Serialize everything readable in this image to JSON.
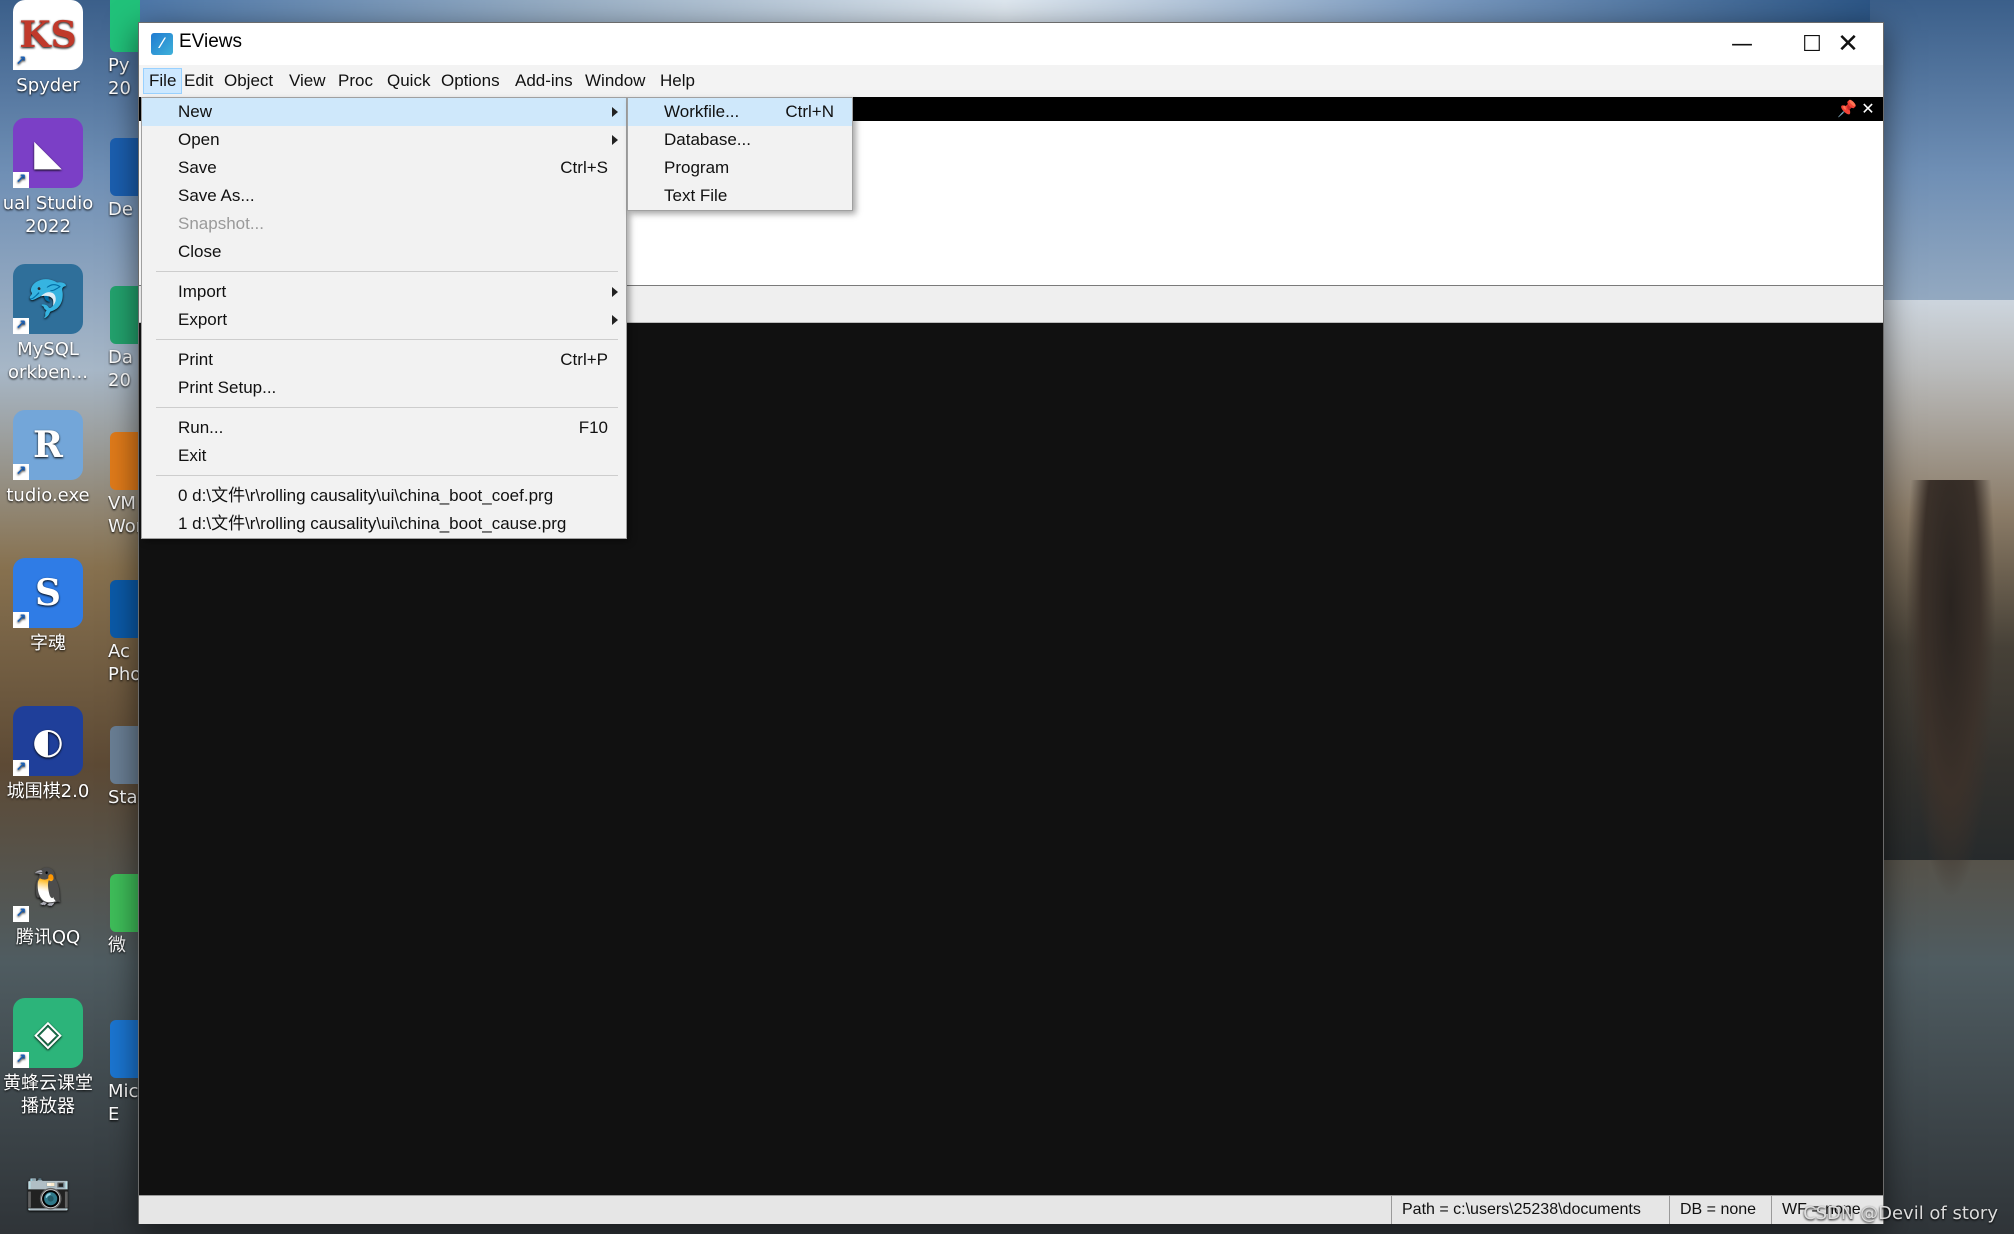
{
  "desktop": {
    "icons": [
      {
        "label": "Spyder",
        "icon": "spyder-icon",
        "glyph": "KS",
        "color": "#ffffff"
      },
      {
        "label": "ual Studio\n2022",
        "icon": "visual-studio-icon",
        "glyph": "◣",
        "color": "#7b3fc6"
      },
      {
        "label": "MySQL\norkben...",
        "icon": "mysql-workbench-icon",
        "glyph": "🐬",
        "color": "#2f6f9a"
      },
      {
        "label": "tudio.exe",
        "icon": "rstudio-icon",
        "glyph": "R",
        "color": "#73a6d9"
      },
      {
        "label": "字魂",
        "icon": "zihun-icon",
        "glyph": "S",
        "color": "#2f7ce6"
      },
      {
        "label": "城围棋2.0",
        "icon": "weiqi-icon",
        "glyph": "◐",
        "color": "#1f3f9a"
      },
      {
        "label": "腾讯QQ",
        "icon": "qq-penguin-icon",
        "glyph": "🐧",
        "color": "#00000000"
      },
      {
        "label": "黄蜂云课堂\n播放器",
        "icon": "wasp-cloud-player-icon",
        "glyph": "◈",
        "color": "#2cb47a"
      },
      {
        "label": "",
        "icon": "camera-icon",
        "glyph": "📷",
        "color": "#00000000"
      }
    ],
    "partial_labels": [
      "Py\n20",
      "De",
      "Da\n20",
      "VM\nWor",
      "Ac\nPho",
      "Stata",
      "微",
      "Mic\nE"
    ],
    "watermark": "CSDN @Devil of story"
  },
  "window": {
    "title": "EViews",
    "minimize_glyph": "—",
    "maximize_glyph": "☐",
    "close_glyph": "✕"
  },
  "menubar": {
    "items": [
      "File",
      "Edit",
      "Object",
      "View",
      "Proc",
      "Quick",
      "Options",
      "Add-ins",
      "Window",
      "Help"
    ]
  },
  "command_pane": {
    "pin_glyph": "📌",
    "close_glyph": "✕"
  },
  "file_menu": {
    "items": [
      {
        "label": "New",
        "shortcut": "",
        "submenu": true,
        "highlighted": true
      },
      {
        "label": "Open",
        "shortcut": "",
        "submenu": true
      },
      {
        "label": "Save",
        "shortcut": "Ctrl+S"
      },
      {
        "label": "Save As...",
        "shortcut": ""
      },
      {
        "label": "Snapshot...",
        "shortcut": "",
        "disabled": true
      },
      {
        "label": "Close",
        "shortcut": ""
      },
      {
        "label": "Import",
        "shortcut": "",
        "submenu": true
      },
      {
        "label": "Export",
        "shortcut": "",
        "submenu": true
      },
      {
        "label": "Print",
        "shortcut": "Ctrl+P"
      },
      {
        "label": "Print Setup...",
        "shortcut": ""
      },
      {
        "label": "Run...",
        "shortcut": "F10"
      },
      {
        "label": "Exit",
        "shortcut": ""
      },
      {
        "label": "0 d:\\文件\\r\\rolling causality\\ui\\china_boot_coef.prg",
        "shortcut": ""
      },
      {
        "label": "1 d:\\文件\\r\\rolling causality\\ui\\china_boot_cause.prg",
        "shortcut": ""
      }
    ]
  },
  "new_submenu": {
    "items": [
      {
        "label": "Workfile...",
        "shortcut": "Ctrl+N",
        "highlighted": true
      },
      {
        "label": "Database...",
        "shortcut": ""
      },
      {
        "label": "Program",
        "shortcut": ""
      },
      {
        "label": "Text File",
        "shortcut": ""
      }
    ]
  },
  "statusbar": {
    "path": "Path = c:\\users\\25238\\documents",
    "db": "DB = none",
    "wf": "WF = none"
  }
}
